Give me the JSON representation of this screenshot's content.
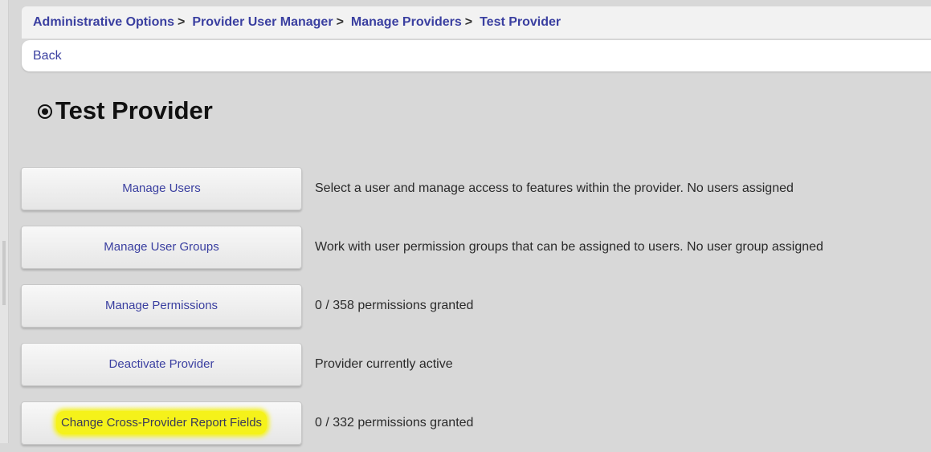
{
  "breadcrumb": {
    "items": [
      {
        "label": "Administrative Options"
      },
      {
        "label": "Provider User Manager"
      },
      {
        "label": "Manage Providers"
      },
      {
        "label": "Test Provider"
      }
    ],
    "separator": ">"
  },
  "back_label": "Back",
  "page": {
    "title": "Test Provider",
    "title_icon": "radio-bullet-icon"
  },
  "actions": [
    {
      "button": "Manage Users",
      "description": "Select a user and manage access to features within the provider. No users assigned"
    },
    {
      "button": "Manage User Groups",
      "description": "Work with user permission groups that can be assigned to users. No user group assigned"
    },
    {
      "button": "Manage Permissions",
      "description": "0 / 358 permissions granted"
    },
    {
      "button": "Deactivate Provider",
      "description": "Provider currently active"
    },
    {
      "button": "Change Cross-Provider Report Fields",
      "description": "0 / 332 permissions granted",
      "highlighted": true
    }
  ],
  "colors": {
    "link": "#3a3fa0",
    "background": "#d8d8d8",
    "highlight": "#f5f21a"
  }
}
